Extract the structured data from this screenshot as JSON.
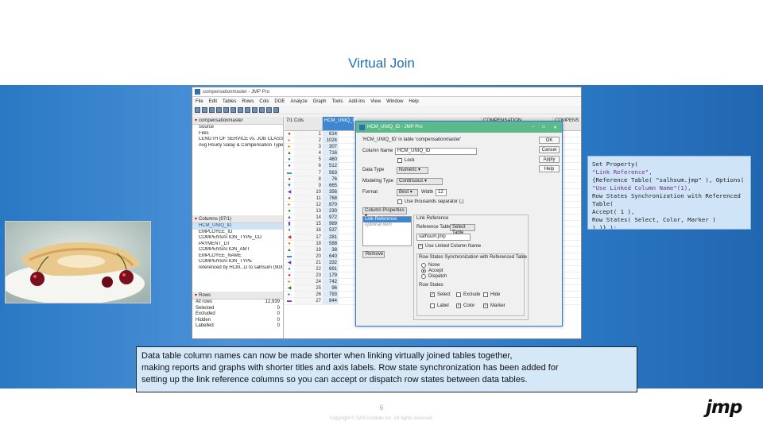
{
  "slide": {
    "title": "Virtual Join",
    "page_number": "6",
    "copyright": "Copyright © SAS Institute Inc. All rights reserved.",
    "logo": "jmp",
    "description_lines": [
      "Data table column names can now be made shorter when linking virtually joined tables together,",
      "making reports and graphs with shorter titles and axis labels.  Row state synchronization has been added for",
      "setting up the link reference  columns so you can accept or dispatch row states  between  data tables."
    ]
  },
  "code": {
    "lines": [
      "Set Property(",
      "\"Link Reference\",",
      "{Reference Table( \"salhsum.jmp\" ), Options(",
      "\"Use Linked Column Name\"(1),",
      "Row States Synchronization with Referenced",
      "Table(",
      "Accept( 1 ),",
      "Row States( Select, Color, Marker )",
      ") )} );"
    ]
  },
  "app": {
    "window_title": "compensationmaster - JMP Pro",
    "menu": [
      "File",
      "Edit",
      "Tables",
      "Rows",
      "Cols",
      "DOE",
      "Analyze",
      "Graph",
      "Tools",
      "Add-Ins",
      "View",
      "Window",
      "Help"
    ],
    "table_panel": {
      "title": "compensationmaster",
      "items": [
        "Source",
        "Files",
        "LENGTH OF SERVICE vs. JOB CLASS",
        "Avg Hourly Salay & Compensation Type"
      ]
    },
    "columns_panel": {
      "title": "Columns (97/1)",
      "items": [
        "HCM_UNIQ_ID",
        "EMPLOYEE_ID",
        "COMPENSATION_TYPE_CD",
        "PAYMENT_DT",
        "COMPENSATION_AMT",
        "EMPLOYEE_NAME",
        "COMPENSATION_TYPE",
        "referenced by HCM...D to salhsum (90/0)"
      ]
    },
    "rows_panel": {
      "title": "Rows",
      "rows": [
        {
          "label": "All rows",
          "value": "12,939"
        },
        {
          "label": "Selected",
          "value": "0"
        },
        {
          "label": "Excluded",
          "value": "0"
        },
        {
          "label": "Hidden",
          "value": "0"
        },
        {
          "label": "Labelled",
          "value": "0"
        }
      ]
    },
    "grid": {
      "header_count": "7/1 Cols",
      "col1_header": "HCM_UNIQ_ID",
      "col_comp_header": "COMPENSATION",
      "col_comps_header": "COMPENS",
      "rows": [
        {
          "n": "1",
          "v": "614"
        },
        {
          "n": "2",
          "v": "1024"
        },
        {
          "n": "3",
          "v": "307"
        },
        {
          "n": "4",
          "v": "716"
        },
        {
          "n": "5",
          "v": "460"
        },
        {
          "n": "6",
          "v": "512"
        },
        {
          "n": "7",
          "v": "563"
        },
        {
          "n": "8",
          "v": "76"
        },
        {
          "n": "9",
          "v": "665"
        },
        {
          "n": "10",
          "v": "356"
        },
        {
          "n": "11",
          "v": "768"
        },
        {
          "n": "12",
          "v": "870"
        },
        {
          "n": "13",
          "v": "230"
        },
        {
          "n": "14",
          "v": "972"
        },
        {
          "n": "15",
          "v": "989"
        },
        {
          "n": "16",
          "v": "537"
        },
        {
          "n": "17",
          "v": "281"
        },
        {
          "n": "18",
          "v": "588"
        },
        {
          "n": "19",
          "v": "38"
        },
        {
          "n": "20",
          "v": "640"
        },
        {
          "n": "21",
          "v": "332"
        },
        {
          "n": "22",
          "v": "691"
        },
        {
          "n": "23",
          "v": "179"
        },
        {
          "n": "24",
          "v": "742"
        },
        {
          "n": "25",
          "v": "96"
        },
        {
          "n": "26",
          "v": "793"
        },
        {
          "n": "27",
          "v": "844"
        }
      ],
      "cut_text": "nus"
    }
  },
  "dialog": {
    "title": "HCM_UNIQ_ID - JMP Pro",
    "subtitle": "'HCM_UNIQ_ID' in table 'compensationmaster'",
    "column_name_label": "Column Name",
    "column_name_value": "HCM_UNIQ_ID",
    "lock_label": "Lock",
    "data_type_label": "Data Type",
    "data_type_value": "Numeric",
    "modeling_type_label": "Modeling Type",
    "modeling_type_value": "Continuous",
    "format_label": "Format",
    "format_value": "Best",
    "width_label": "Width",
    "width_value": "12",
    "thousands_label": "Use thousands separator (,)",
    "column_properties_label": "Column Properties",
    "properties": [
      "Link Reference",
      "optional item"
    ],
    "remove_label": "Remove",
    "link_reference_title": "Link Reference",
    "reference_table_label": "Reference Table",
    "select_table_label": "Select Table",
    "reference_table_value": "salhsum.jmp",
    "use_linked_label": "Use Linked Column Name",
    "sync_title": "Row States Synchronization with Referenced Table",
    "sync_options": [
      "None",
      "Accept",
      "Dispatch"
    ],
    "row_states_label": "Row States",
    "row_state_options": [
      "Select",
      "Exclude",
      "Hide",
      "Label",
      "Color",
      "Marker"
    ],
    "buttons": [
      "OK",
      "Cancel",
      "Apply",
      "Help"
    ]
  }
}
